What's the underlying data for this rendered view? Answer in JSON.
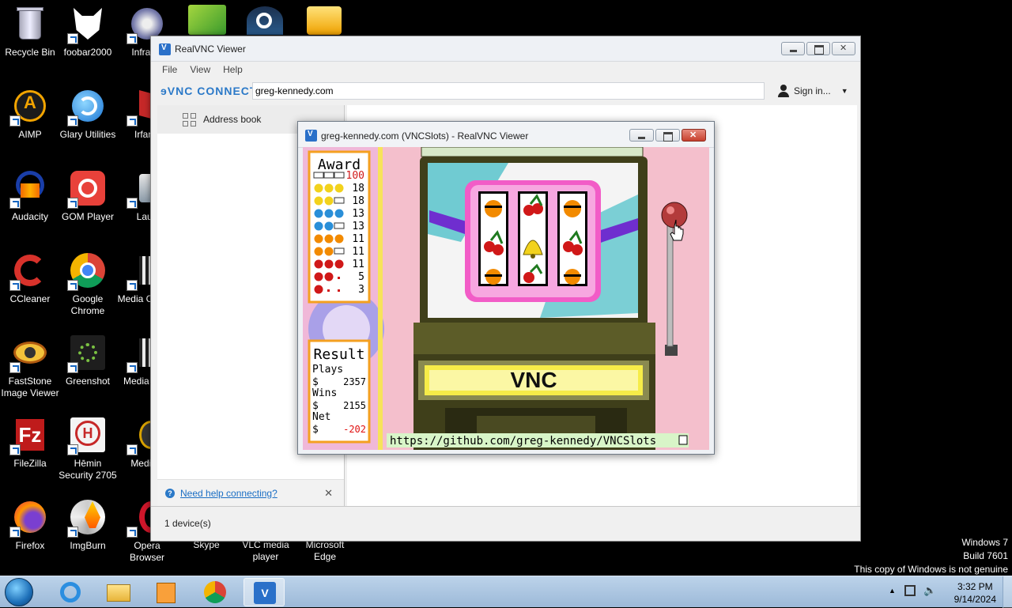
{
  "desktop": {
    "icons": [
      {
        "label": "Recycle Bin"
      },
      {
        "label": "foobar2000"
      },
      {
        "label": "InfraRe"
      },
      {
        "label": "AIMP"
      },
      {
        "label": "Glary Utilities"
      },
      {
        "label": "IrfanV"
      },
      {
        "label": "Audacity"
      },
      {
        "label": "GOM Player"
      },
      {
        "label": "Laun"
      },
      {
        "label": "CCleaner"
      },
      {
        "label": "Google Chrome"
      },
      {
        "label": "Media Classic"
      },
      {
        "label": "FastStone Image Viewer"
      },
      {
        "label": "Greenshot"
      },
      {
        "label": "Media Clas"
      },
      {
        "label": "FileZilla"
      },
      {
        "label": "Hēmin Security 2705"
      },
      {
        "label": "MediaN"
      },
      {
        "label": "Firefox"
      },
      {
        "label": "ImgBurn"
      },
      {
        "label": "Opera Browser"
      },
      {
        "label": "Skype"
      },
      {
        "label": "VLC media player"
      },
      {
        "label": "Microsoft Edge"
      }
    ]
  },
  "viewer": {
    "title": "RealVNC Viewer",
    "menu": [
      "File",
      "View",
      "Help"
    ],
    "brand": "ɘVNC CONNECT",
    "address_value": "greg-kennedy.com",
    "sign_in": "Sign in...",
    "address_book": "Address book",
    "help_link": "Need help connecting?",
    "status": "1 device(s)"
  },
  "session": {
    "title": "greg-kennedy.com (VNCSlots) - RealVNC Viewer",
    "award_title": "Award",
    "award_rows": [
      {
        "symbols": "BAR BAR BAR",
        "value": "100"
      },
      {
        "symbols": "bell bell bell",
        "value": "18"
      },
      {
        "symbols": "bell bell bar",
        "value": "18"
      },
      {
        "symbols": "plum plum plum",
        "value": "13"
      },
      {
        "symbols": "plum plum bar",
        "value": "13"
      },
      {
        "symbols": "orange orange orange",
        "value": "11"
      },
      {
        "symbols": "orange orange bar",
        "value": "11"
      },
      {
        "symbols": "cherry cherry cherry",
        "value": "11"
      },
      {
        "symbols": "cherry cherry any",
        "value": "5"
      },
      {
        "symbols": "cherry any any",
        "value": "3"
      }
    ],
    "result_title": "Result",
    "plays_label": "Plays",
    "plays_value": "2357",
    "wins_label": "Wins",
    "wins_value": "2155",
    "net_label": "Net",
    "net_value": "-202",
    "currency": "$",
    "marquee_logo": "VNC",
    "url": "https://github.com/greg-kennedy/VNCSlots"
  },
  "taskbar": {
    "time": "3:32 PM",
    "date": "9/14/2024"
  },
  "watermark": {
    "line1": "Windows 7",
    "line2": "Build 7601",
    "line3": "This copy of Windows is not genuine"
  },
  "colors": {
    "accent": "#2b79c8",
    "award_border": "#f4a020",
    "net_negative": "#e01010"
  }
}
